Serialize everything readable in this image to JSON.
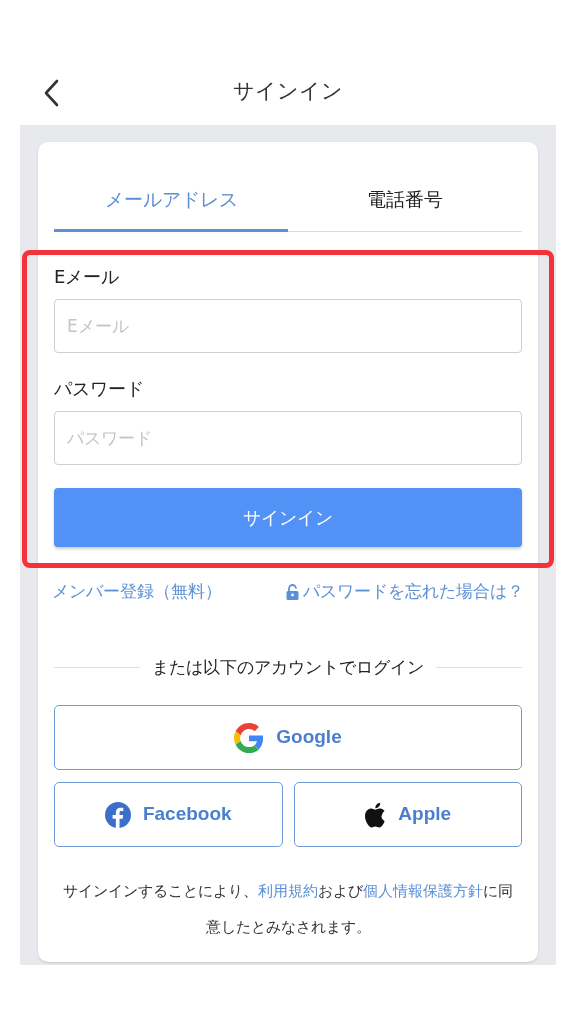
{
  "header": {
    "title": "サインイン"
  },
  "tabs": [
    {
      "label": "メールアドレス",
      "selected": true
    },
    {
      "label": "電話番号",
      "selected": false
    }
  ],
  "fields": [
    {
      "label": "Eメール",
      "placeholder": "Eメール"
    },
    {
      "label": "パスワード",
      "placeholder": "パスワード"
    }
  ],
  "submit": "サインイン",
  "links": [
    {
      "label": "メンバー登録（無料）",
      "kind": "plain"
    },
    {
      "label": "パスワードを忘れた場合は？",
      "kind": "lock"
    }
  ],
  "divider": "または以下のアカウントでログイン",
  "social": [
    {
      "label": "Google",
      "kind": "google"
    },
    {
      "label": "Facebook",
      "kind": "facebook"
    },
    {
      "label": "Apple",
      "kind": "apple"
    }
  ],
  "terms": [
    {
      "kind": "text",
      "text": "サインインすることにより、"
    },
    {
      "kind": "link",
      "text": "利用規約"
    },
    {
      "kind": "text",
      "text": "および"
    },
    {
      "kind": "link",
      "text": "個人情報保護方針"
    },
    {
      "kind": "text",
      "text": "に同意したとみなされます。"
    }
  ]
}
